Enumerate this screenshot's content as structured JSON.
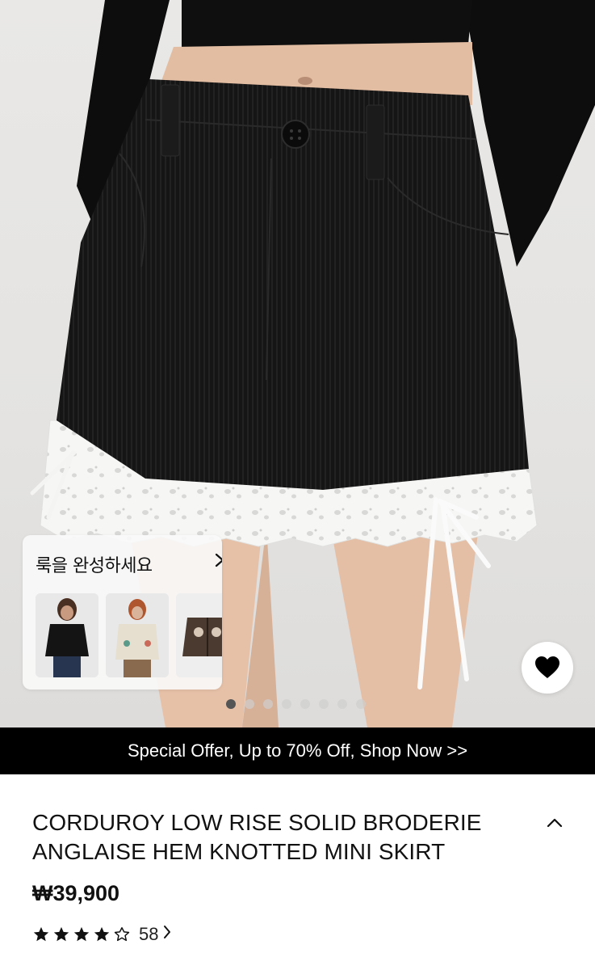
{
  "hero": {
    "image_alt_subject": "black corduroy mini skirt with white broderie anglaise hem",
    "carousel": {
      "total": 8,
      "active_index": 0
    }
  },
  "complete_look": {
    "title": "룩을 완성하세요",
    "chevron_icon": "chevron-right-icon",
    "thumbnails": [
      {
        "name": "black-zip-cardigan"
      },
      {
        "name": "cream-knit-cardigan"
      },
      {
        "name": "brown-pattern-cardigan"
      }
    ]
  },
  "wishlist": {
    "icon": "heart-icon"
  },
  "promo": {
    "text": "Special Offer, Up to 70% Off, Shop Now >>"
  },
  "product": {
    "title": "CORDUROY LOW RISE SOLID BRODERIE ANGLAISE HEM KNOTTED MINI SKIRT",
    "price": "₩39,900",
    "rating": {
      "value": 4.5,
      "max": 5
    },
    "review_count": "58"
  },
  "colors": {
    "banner_bg": "#000000",
    "text": "#111111"
  }
}
